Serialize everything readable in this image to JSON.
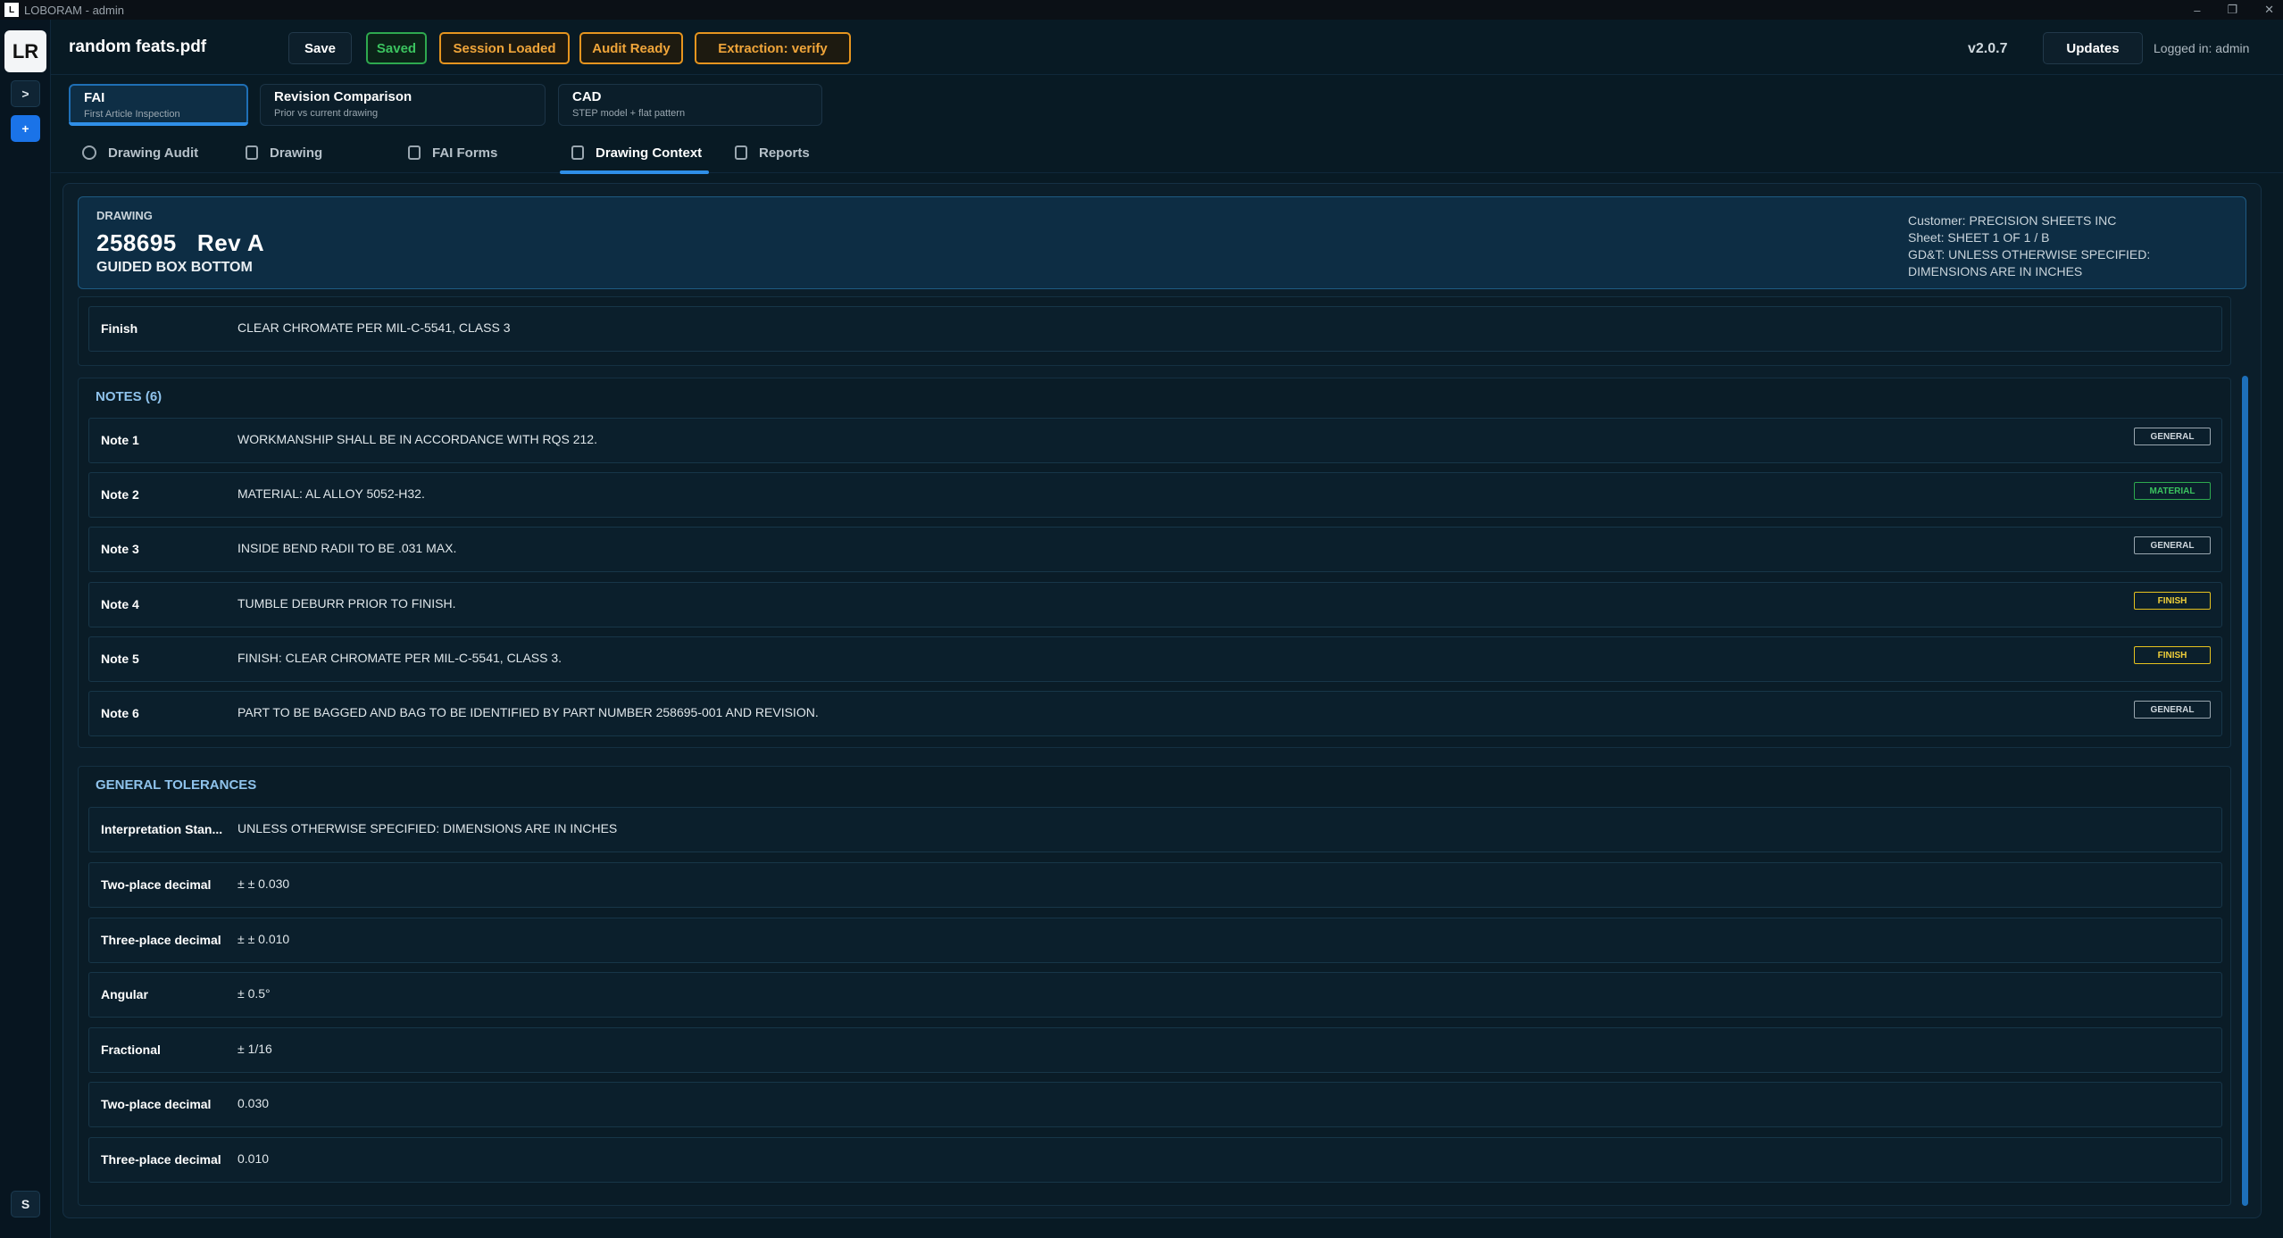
{
  "window": {
    "title": "LOBORAM - admin",
    "controls": [
      "–",
      "❐",
      "✕"
    ]
  },
  "rail": {
    "logo": "LR",
    "expand": ">",
    "add": "+",
    "avatar": "S"
  },
  "header": {
    "filename": "random feats.pdf",
    "save": "Save",
    "saved": "Saved",
    "session": "Session Loaded",
    "audit": "Audit Ready",
    "extraction": "Extraction: verify",
    "version": "v2.0.7",
    "updates": "Updates",
    "logged_in": "Logged in: admin"
  },
  "modes": [
    {
      "title": "FAI",
      "subtitle": "First Article Inspection"
    },
    {
      "title": "Revision Comparison",
      "subtitle": "Prior vs current drawing"
    },
    {
      "title": "CAD",
      "subtitle": "STEP model + flat pattern"
    }
  ],
  "tabs": [
    "Drawing Audit",
    "Drawing",
    "FAI Forms",
    "Drawing Context",
    "Reports"
  ],
  "active_tab": "Drawing Context",
  "drawing": {
    "label": "DRAWING",
    "number": "258695   Rev A",
    "description": "GUIDED BOX BOTTOM",
    "customer": "Customer: PRECISION SHEETS INC",
    "sheet": "Sheet: SHEET 1 OF 1 / B",
    "gdt": "GD&T: UNLESS OTHERWISE SPECIFIED: DIMENSIONS ARE IN INCHES"
  },
  "finish_row": {
    "label": "Finish",
    "value": "CLEAR CHROMATE PER MIL-C-5541, CLASS 3"
  },
  "notes": {
    "title": "NOTES (6)",
    "items": [
      {
        "label": "Note 1",
        "text": "WORKMANSHIP SHALL BE IN ACCORDANCE WITH RQS 212.",
        "tag": "GENERAL"
      },
      {
        "label": "Note 2",
        "text": "MATERIAL: AL ALLOY 5052-H32.",
        "tag": "MATERIAL"
      },
      {
        "label": "Note 3",
        "text": "INSIDE BEND RADII TO BE .031 MAX.",
        "tag": "GENERAL"
      },
      {
        "label": "Note 4",
        "text": "TUMBLE DEBURR PRIOR TO FINISH.",
        "tag": "FINISH"
      },
      {
        "label": "Note 5",
        "text": "FINISH: CLEAR CHROMATE PER MIL-C-5541, CLASS 3.",
        "tag": "FINISH"
      },
      {
        "label": "Note 6",
        "text": "PART TO BE BAGGED AND BAG TO BE IDENTIFIED BY PART NUMBER 258695-001 AND REVISION.",
        "tag": "GENERAL"
      }
    ]
  },
  "tolerances": {
    "title": "GENERAL TOLERANCES",
    "items": [
      {
        "label": "Interpretation Stan...",
        "value": "UNLESS OTHERWISE SPECIFIED: DIMENSIONS ARE IN INCHES"
      },
      {
        "label": "Two-place decimal",
        "value": "± ± 0.030"
      },
      {
        "label": "Three-place decimal",
        "value": "± ± 0.010"
      },
      {
        "label": "Angular",
        "value": "± 0.5°"
      },
      {
        "label": "Fractional",
        "value": "± 1/16"
      },
      {
        "label": "Two-place decimal",
        "value": "0.030"
      },
      {
        "label": "Three-place decimal",
        "value": "0.010"
      }
    ]
  },
  "colors": {
    "accent": "#2f8fe8",
    "saved": "#3bc35f",
    "warning": "#f0a53a",
    "finish_tag": "#f0cf3a"
  }
}
